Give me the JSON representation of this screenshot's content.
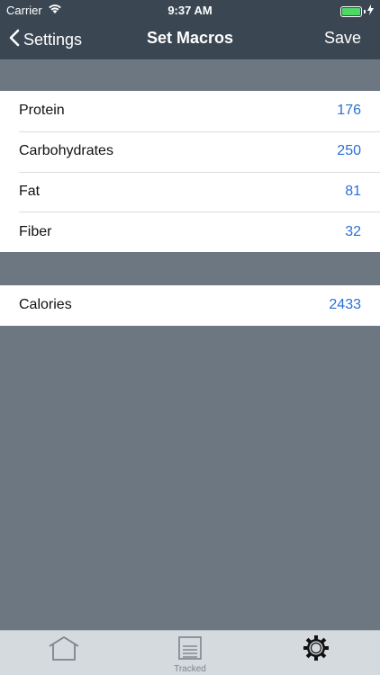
{
  "status_bar": {
    "carrier": "Carrier",
    "time": "9:37 AM",
    "battery_level": 1.0
  },
  "nav": {
    "back_label": "Settings",
    "title": "Set Macros",
    "save_label": "Save"
  },
  "macros": [
    {
      "label": "Protein",
      "value": "176"
    },
    {
      "label": "Carbohydrates",
      "value": "250"
    },
    {
      "label": "Fat",
      "value": "81"
    },
    {
      "label": "Fiber",
      "value": "32"
    }
  ],
  "calories": {
    "label": "Calories",
    "value": "2433"
  },
  "tabs": [
    {
      "icon": "home-icon",
      "label": ""
    },
    {
      "icon": "tracked-icon",
      "label": "Tracked"
    },
    {
      "icon": "gear-icon",
      "label": ""
    }
  ],
  "colors": {
    "header": "#3a4753",
    "background": "#6d7782",
    "value_blue": "#2a6fd6",
    "tab_bar": "#d5dadf"
  }
}
